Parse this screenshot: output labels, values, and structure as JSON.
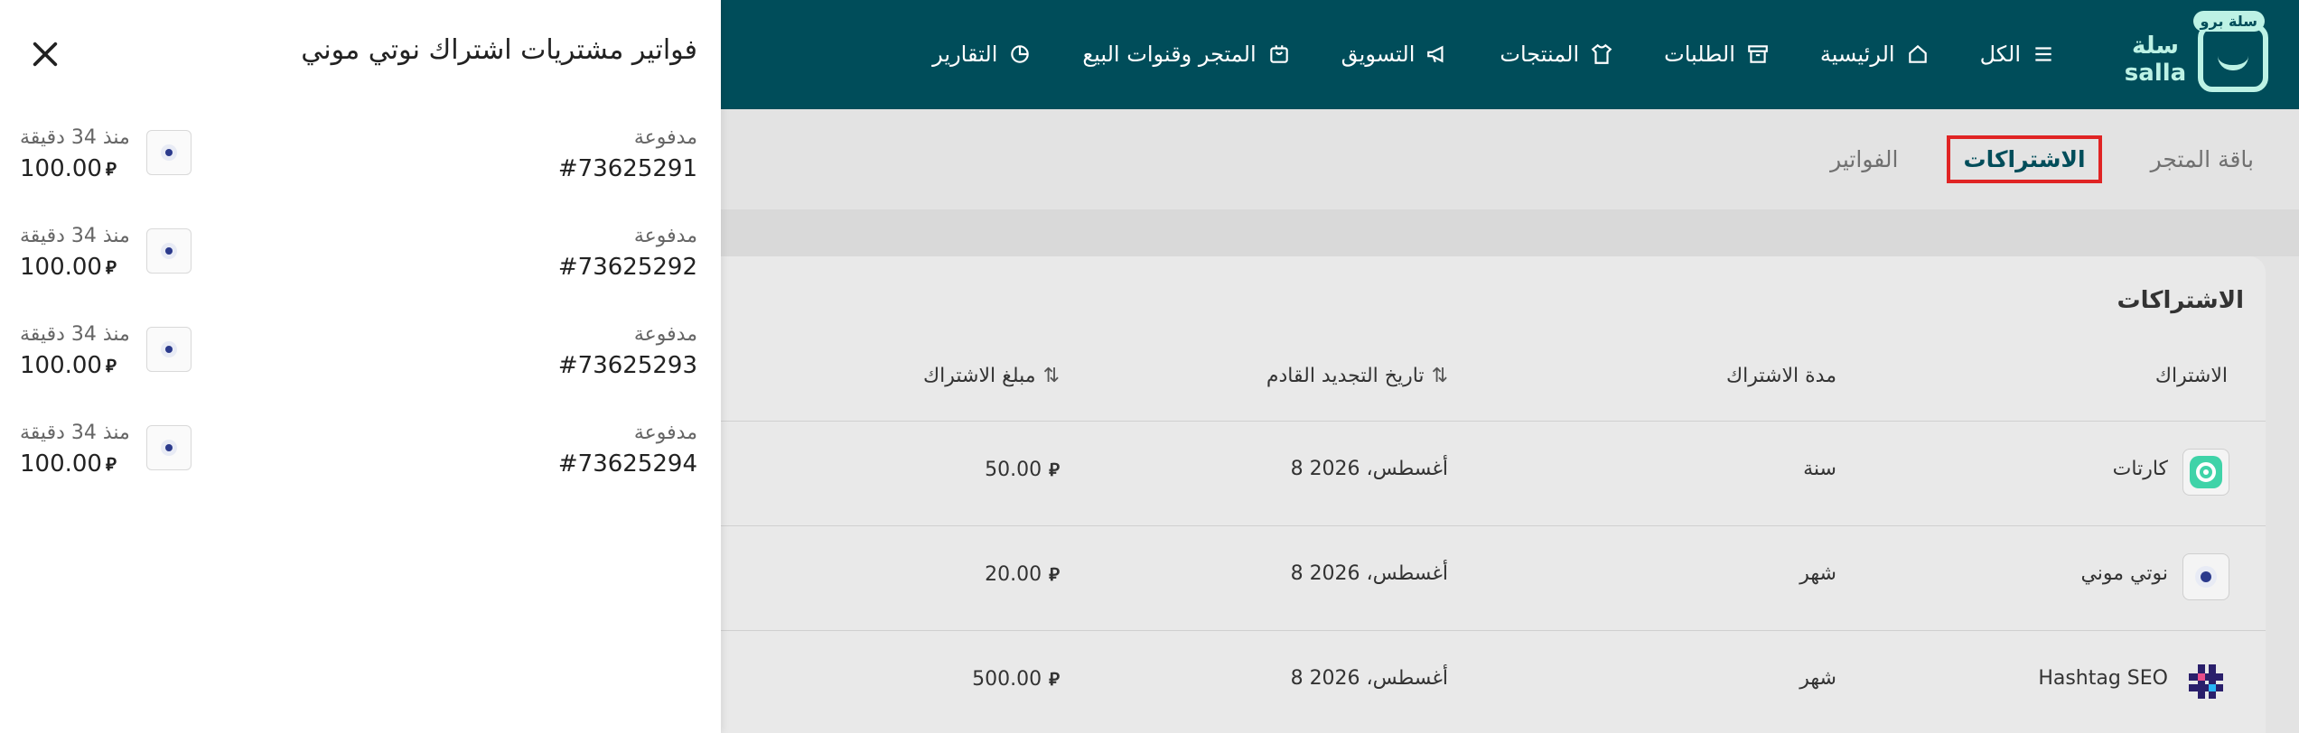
{
  "topbar": {
    "logo_text": "سلة\nsalla",
    "logo_badge": "سلة برو",
    "nav": [
      {
        "label": "الكل",
        "icon": "menu-icon"
      },
      {
        "label": "الرئيسية",
        "icon": "home-icon"
      },
      {
        "label": "الطلبات",
        "icon": "archive-box-icon"
      },
      {
        "label": "المنتجات",
        "icon": "shirt-icon"
      },
      {
        "label": "التسويق",
        "icon": "megaphone-icon"
      },
      {
        "label": "المتجر وقنوات البيع",
        "icon": "store-icon"
      },
      {
        "label": "التقارير",
        "icon": "pie-chart-icon"
      }
    ]
  },
  "tabs": [
    {
      "label": "باقة المتجر",
      "active": false
    },
    {
      "label": "الاشتراكات",
      "active": true
    },
    {
      "label": "الفواتير",
      "active": false
    }
  ],
  "subscriptions": {
    "title": "الاشتراكات",
    "columns": {
      "subscription": "الاشتراك",
      "duration": "مدة الاشتراك",
      "renewal": "تاريخ التجديد القادم",
      "amount": "مبلغ الاشتراك"
    },
    "rows": [
      {
        "name": "كارتات",
        "duration": "سنة",
        "renewal": "8 أغسطس، 2026",
        "amount": "50.00",
        "icon": "kartat-app-icon"
      },
      {
        "name": "نوتي موني",
        "duration": "شهر",
        "renewal": "8 أغسطس، 2026",
        "amount": "20.00",
        "icon": "notty-money-app-icon"
      },
      {
        "name": "Hashtag SEO",
        "duration": "شهر",
        "renewal": "8 أغسطس، 2026",
        "amount": "500.00",
        "icon": "hashtag-seo-app-icon"
      }
    ]
  },
  "drawer": {
    "title": "فواتير مشتريات اشتراك نوتي موني",
    "invoices": [
      {
        "status": "مدفوعة",
        "number": "#73625291",
        "time": "منذ 34 دقيقة",
        "amount": "100.00"
      },
      {
        "status": "مدفوعة",
        "number": "#73625292",
        "time": "منذ 34 دقيقة",
        "amount": "100.00"
      },
      {
        "status": "مدفوعة",
        "number": "#73625293",
        "time": "منذ 34 دقيقة",
        "amount": "100.00"
      },
      {
        "status": "مدفوعة",
        "number": "#73625294",
        "time": "منذ 34 دقيقة",
        "amount": "100.00"
      }
    ]
  },
  "colors": {
    "topbar": "#004d5a",
    "logo": "#bdf2e5",
    "active_tab_outline": "#e02424"
  }
}
